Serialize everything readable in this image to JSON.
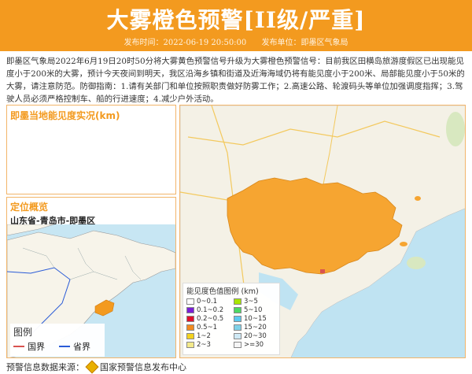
{
  "header": {
    "title": "大雾橙色预警[II级/严重]",
    "publish_time": "发布时间：2022-06-19 20:50:00",
    "publisher": "发布单位：即墨区气象局"
  },
  "description": "即墨区气象局2022年6月19日20时50分将大雾黄色预警信号升级为大雾橙色预警信号：目前我区田横岛旅游度假区已出现能见度小于200米的大雾，预计今天夜间到明天，我区沿海乡镇和街道及近海海域仍将有能见度小于200米、局部能见度小于50米的大雾，请注意防范。防御指南：1.请有关部门和单位按照职责做好防雾工作；2.高速公路、轮渡码头等单位加强调度指挥；3.驾驶人员必须严格控制车、船的行进速度；4.减少户外活动。",
  "visibility_panel": {
    "title": "即墨当地能见度实况(km)"
  },
  "location_panel": {
    "title": "定位概览",
    "path": "山东省-青岛市-即墨区",
    "legend_title": "图例",
    "legend_items": [
      {
        "label": "国界",
        "color": "#d9534f"
      },
      {
        "label": "省界",
        "color": "#2a5bd7"
      }
    ]
  },
  "visibility_legend": {
    "title": "能见度色值图例 (km)",
    "items": [
      {
        "label": "0~0.1",
        "color": "#ffffff"
      },
      {
        "label": "3~5",
        "color": "#a8e600"
      },
      {
        "label": "0.1~0.2",
        "color": "#7a1fd6"
      },
      {
        "label": "5~10",
        "color": "#4cd964"
      },
      {
        "label": "0.2~0.5",
        "color": "#e0102b"
      },
      {
        "label": "10~15",
        "color": "#5cc9f0"
      },
      {
        "label": "0.5~1",
        "color": "#f28a1f"
      },
      {
        "label": "15~20",
        "color": "#7fd1e8"
      },
      {
        "label": "1~2",
        "color": "#f3d21f"
      },
      {
        "label": "20~30",
        "color": "#cfe9f5"
      },
      {
        "label": "2~3",
        "color": "#f3e98a"
      },
      {
        "label": ">=30",
        "color": "#f5f5f5"
      }
    ]
  },
  "source": {
    "label": "预警信息数据来源：",
    "provider": "国家预警信息发布中心"
  },
  "colors": {
    "accent": "#f39a1f",
    "warning_area": "#f6a531",
    "sea": "#bfe3f2"
  }
}
